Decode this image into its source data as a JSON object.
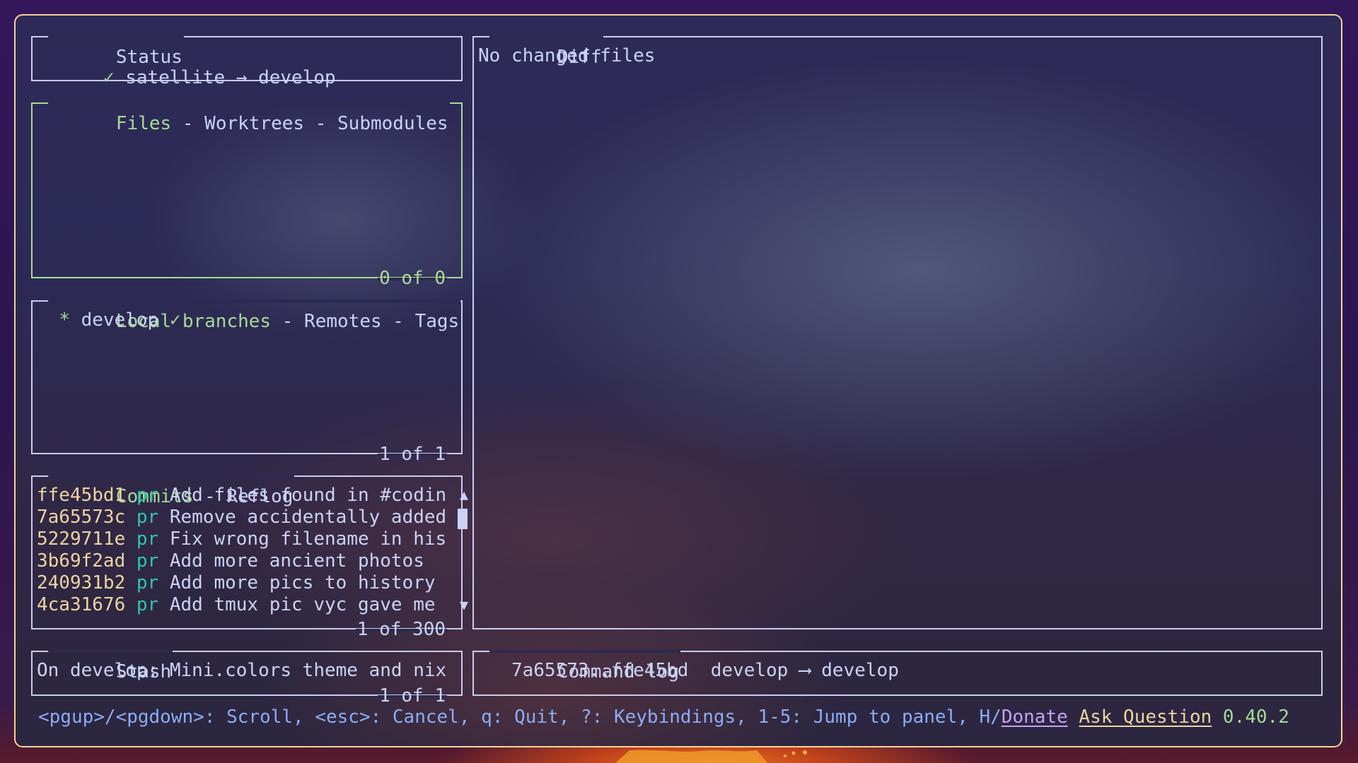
{
  "status": {
    "title": "Status",
    "check_icon": "✓",
    "repo": "satellite",
    "arrow": "→",
    "branch": "develop"
  },
  "files": {
    "tabs": [
      "Files",
      "Worktrees",
      "Submodules"
    ],
    "separator": " - ",
    "active_tab": 0,
    "counter": "0 of 0"
  },
  "branches": {
    "tabs": [
      "Local branches",
      "Remotes",
      "Tags"
    ],
    "separator": " - ",
    "active_tab": 0,
    "items": [
      {
        "marker": "*",
        "name": "develop",
        "status_icon": "✓"
      }
    ],
    "counter": "1 of 1"
  },
  "commits": {
    "tabs": [
      "Commits",
      "Reflog"
    ],
    "separator": " - ",
    "active_tab": 0,
    "items": [
      {
        "hash": "ffe45bd1",
        "author": "pr",
        "message": "Add files found in #codin"
      },
      {
        "hash": "7a65573c",
        "author": "pr",
        "message": "Remove accidentally added"
      },
      {
        "hash": "5229711e",
        "author": "pr",
        "message": "Fix wrong filename in his"
      },
      {
        "hash": "3b69f2ad",
        "author": "pr",
        "message": "Add more ancient photos"
      },
      {
        "hash": "240931b2",
        "author": "pr",
        "message": "Add more pics to history"
      },
      {
        "hash": "4ca31676",
        "author": "pr",
        "message": "Add tmux pic vyc gave me"
      }
    ],
    "counter": "1 of 300",
    "scroll_up_icon": "▲",
    "scroll_down_icon": "▼"
  },
  "stash": {
    "title": "Stash",
    "items": [
      "On develop: Mini.colors theme and nix"
    ],
    "counter": "1 of 1"
  },
  "diff": {
    "title": "Diff",
    "content": "No changed files"
  },
  "command_log": {
    "title": "Command log",
    "entries": [
      {
        "range": "7a65573..ffe45bd",
        "from": "develop",
        "arrow": "⟶",
        "to": "develop"
      }
    ]
  },
  "footer": {
    "keybindings": "<pgup>/<pgdown>: Scroll, <esc>: Cancel, q: Quit, ?: Keybindings, 1-5: Jump to panel, H/",
    "donate_label": "Donate",
    "ask_label": "Ask Question",
    "version": "0.40.2"
  },
  "colors": {
    "active_border": "#a6da95",
    "inactive_border": "#c9cdf0",
    "text": "#cad3f5",
    "hash": "#eed49f",
    "author": "#2ec4b6",
    "keybind": "#8aadf4",
    "donate": "#c6a0f6",
    "ask": "#eed49f",
    "version": "#a6da95",
    "window_frame": "#f2d49a"
  }
}
